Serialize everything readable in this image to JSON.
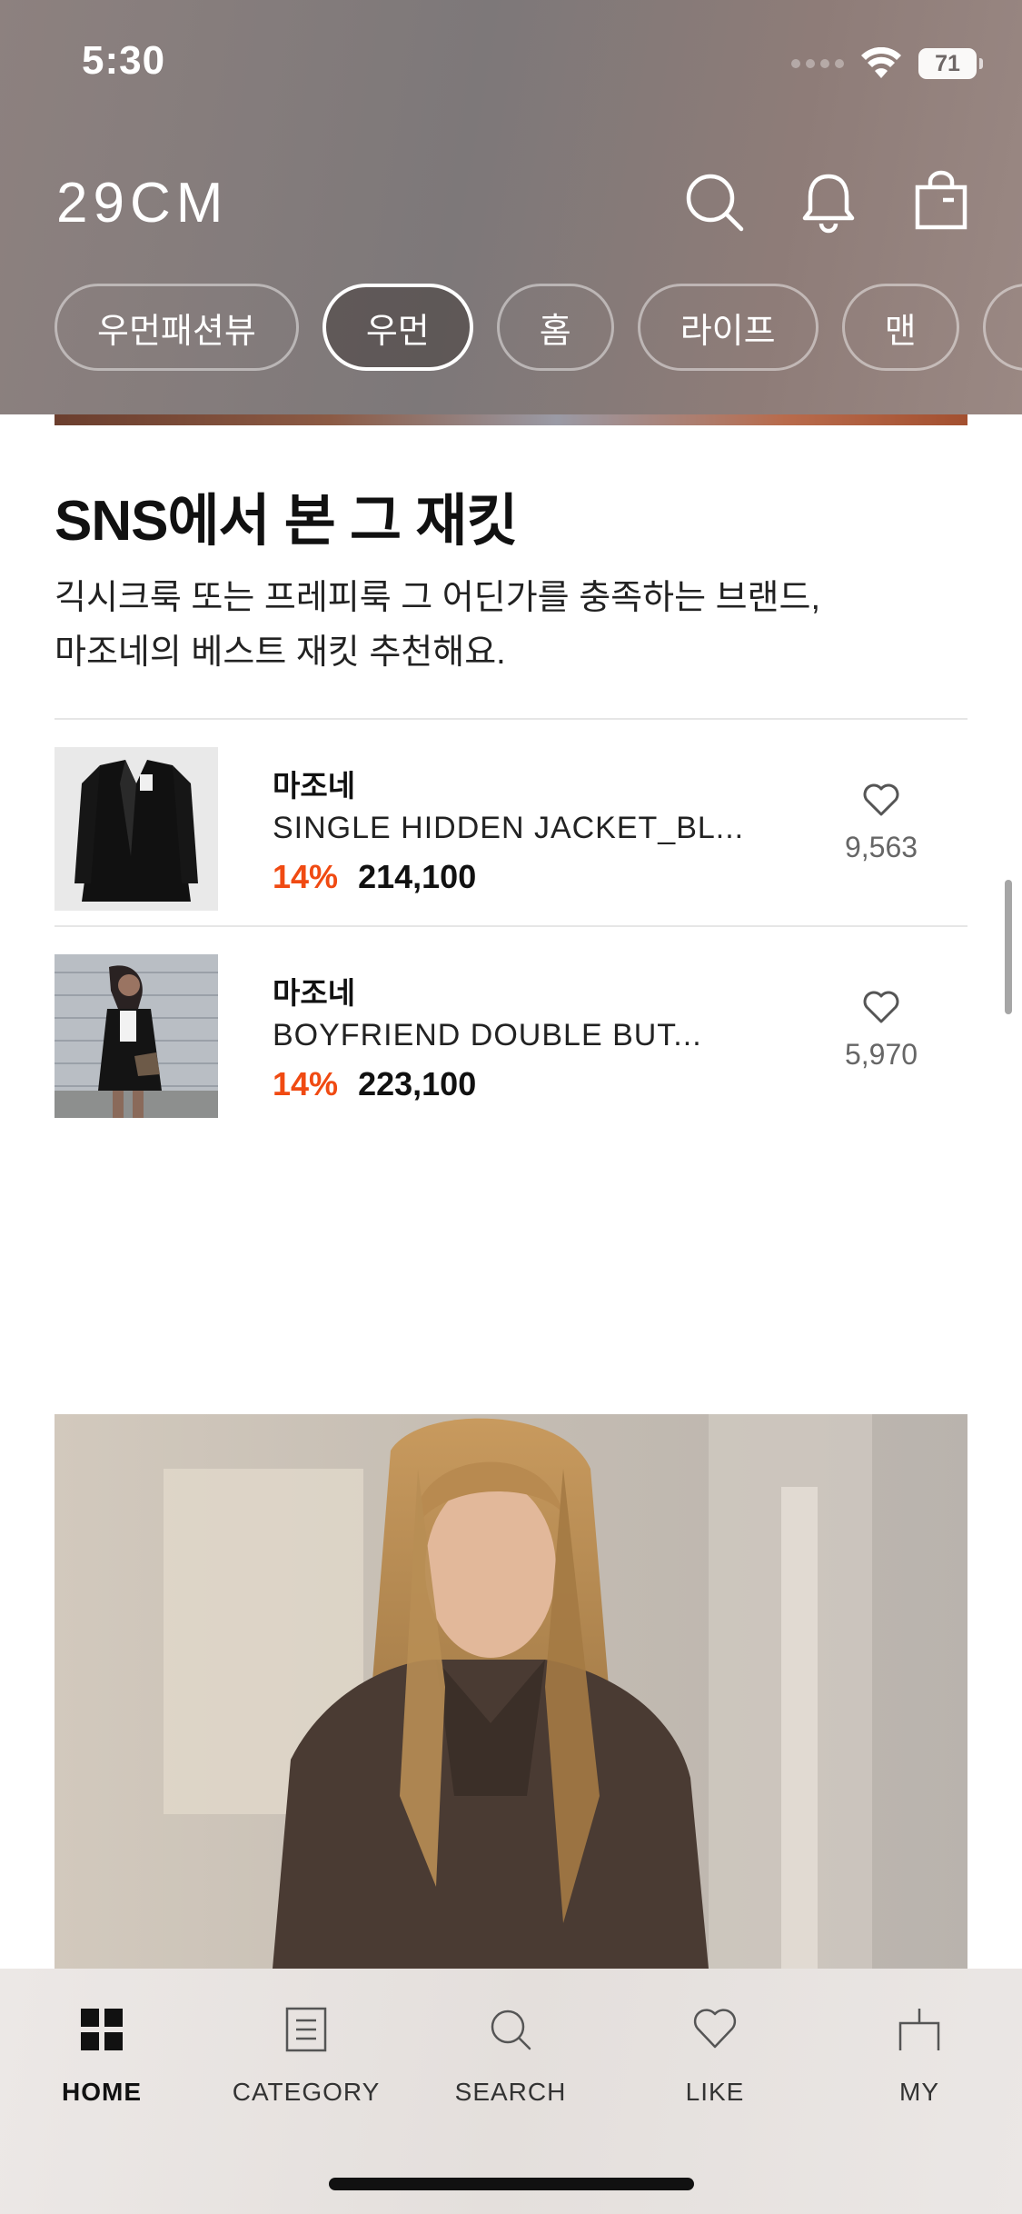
{
  "status_bar": {
    "time": "5:30",
    "battery": "71"
  },
  "header": {
    "logo": "29CM",
    "icons": [
      "search-icon",
      "bell-icon",
      "shopping-bag-icon"
    ]
  },
  "category_chips": [
    {
      "label": "우먼패션뷰",
      "active": false
    },
    {
      "label": "우먼",
      "active": true
    },
    {
      "label": "홈",
      "active": false
    },
    {
      "label": "라이프",
      "active": false
    },
    {
      "label": "맨",
      "active": false
    }
  ],
  "section": {
    "title": "SNS에서 본 그 재킷",
    "description_line1": "긱시크룩 또는 프레피룩 그 어딘가를 충족하는 브랜드,",
    "description_line2": "마조네의 베스트 재킷 추천해요."
  },
  "products": [
    {
      "brand": "마조네",
      "name": "SINGLE HIDDEN JACKET_BL...",
      "discount": "14%",
      "price": "214,100",
      "likes": "9,563"
    },
    {
      "brand": "마조네",
      "name": "BOYFRIEND DOUBLE BUT...",
      "discount": "14%",
      "price": "223,100",
      "likes": "5,970"
    }
  ],
  "bottom_nav": [
    {
      "label": "HOME",
      "icon": "home-grid-icon",
      "active": true
    },
    {
      "label": "CATEGORY",
      "icon": "category-list-icon",
      "active": false
    },
    {
      "label": "SEARCH",
      "icon": "search-icon",
      "active": false
    },
    {
      "label": "LIKE",
      "icon": "heart-icon",
      "active": false
    },
    {
      "label": "MY",
      "icon": "my-page-icon",
      "active": false
    }
  ],
  "colors": {
    "accent_discount": "#f04a12",
    "header_bg": "#857c7b",
    "nav_bg": "#e8e4e2"
  }
}
